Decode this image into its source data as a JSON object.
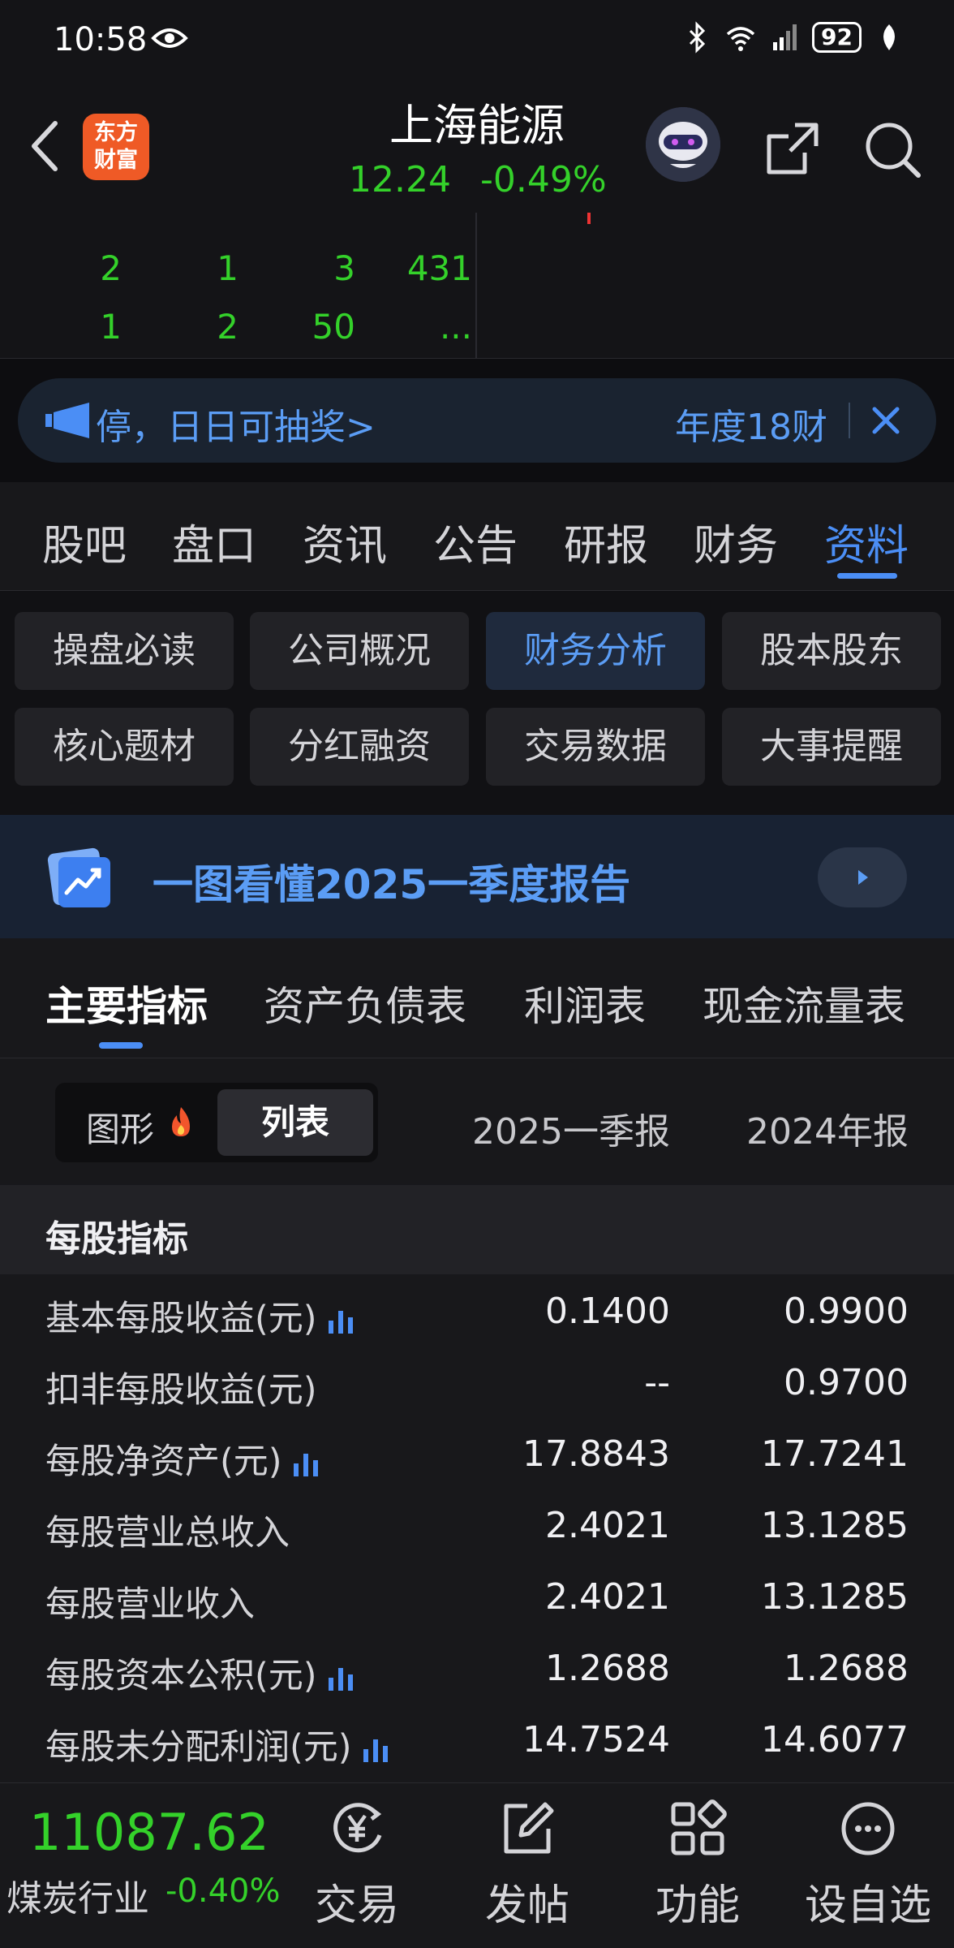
{
  "status_bar": {
    "time": "10:58",
    "battery": "92"
  },
  "header": {
    "stock_name": "上海能源",
    "price": "12.24",
    "change_pct": "-0.49%",
    "logo_line1": "东方",
    "logo_line2": "财富"
  },
  "orderbook": {
    "rows": [
      [
        "2",
        "1",
        "3",
        "431"
      ],
      [
        "1",
        "2",
        "50",
        "..."
      ]
    ]
  },
  "notice": {
    "text": "停，日日可抽奖>",
    "text2": "年度18财"
  },
  "main_tabs": [
    "股吧",
    "盘口",
    "资讯",
    "公告",
    "研报",
    "财务",
    "资料"
  ],
  "main_tab_active": "资料",
  "sub_nav": [
    "操盘必读",
    "公司概况",
    "财务分析",
    "股本股东",
    "核心题材",
    "分红融资",
    "交易数据",
    "大事提醒"
  ],
  "sub_nav_active": "财务分析",
  "report_banner": {
    "text": "一图看懂2025一季度报告"
  },
  "finance_tabs": [
    "主要指标",
    "资产负债表",
    "利润表",
    "现金流量表"
  ],
  "finance_tab_active": "主要指标",
  "view_toggle": {
    "graph": "图形",
    "list": "列表",
    "active": "列表"
  },
  "columns": [
    "2025一季报",
    "2024年报"
  ],
  "section_title": "每股指标",
  "rows": [
    {
      "label": "基本每股收益(元)",
      "chart": true,
      "v1": "0.1400",
      "v2": "0.9900"
    },
    {
      "label": "扣非每股收益(元)",
      "chart": false,
      "v1": "--",
      "v2": "0.9700"
    },
    {
      "label": "每股净资产(元)",
      "chart": true,
      "v1": "17.8843",
      "v2": "17.7241"
    },
    {
      "label": "每股营业总收入",
      "chart": false,
      "v1": "2.4021",
      "v2": "13.1285"
    },
    {
      "label": "每股营业收入",
      "chart": false,
      "v1": "2.4021",
      "v2": "13.1285"
    },
    {
      "label": "每股资本公积(元)",
      "chart": true,
      "v1": "1.2688",
      "v2": "1.2688"
    },
    {
      "label": "每股未分配利润(元)",
      "chart": true,
      "v1": "14.7524",
      "v2": "14.6077"
    }
  ],
  "bottom_bar": {
    "index_value": "11087.62",
    "index_name": "煤炭行业",
    "index_change": "-0.40%",
    "items": [
      "交易",
      "发帖",
      "功能",
      "设自选"
    ]
  },
  "colors": {
    "accent": "#4b8ef5",
    "down": "#34d12a",
    "background": "#111114"
  }
}
